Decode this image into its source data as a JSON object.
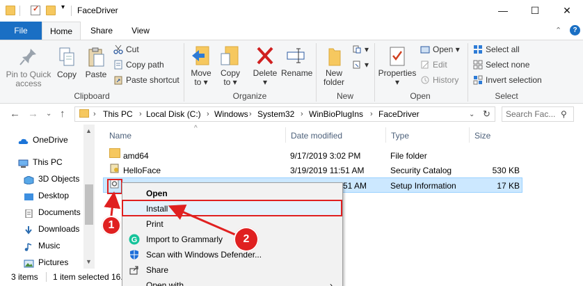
{
  "window": {
    "title": "FaceDriver",
    "minimize": "—",
    "maximize": "☐",
    "close": "✕"
  },
  "tabs": {
    "file": "File",
    "home": "Home",
    "share": "Share",
    "view": "View",
    "help": "?"
  },
  "ribbon": {
    "clipboard": {
      "label": "Clipboard",
      "pin": [
        "Pin to Quick",
        "access"
      ],
      "copy": "Copy",
      "paste": "Paste",
      "cut": "Cut",
      "copy_path": "Copy path",
      "paste_shortcut": "Paste shortcut"
    },
    "organize": {
      "label": "Organize",
      "move_to": [
        "Move",
        "to ▾"
      ],
      "copy_to": [
        "Copy",
        "to ▾"
      ],
      "delete": [
        "Delete",
        "▾"
      ],
      "rename": "Rename"
    },
    "new": {
      "label": "New",
      "new_folder": [
        "New",
        "folder"
      ]
    },
    "open": {
      "label": "Open",
      "properties": [
        "Properties",
        "▾"
      ],
      "open": "Open ▾",
      "edit": "Edit",
      "history": "History"
    },
    "select": {
      "label": "Select",
      "select_all": "Select all",
      "select_none": "Select none",
      "invert": "Invert selection"
    }
  },
  "address": {
    "crumbs": [
      "This PC",
      "Local Disk (C:)",
      "Windows",
      "System32",
      "WinBioPlugIns",
      "FaceDriver"
    ],
    "search_placeholder": "Search Fac..."
  },
  "nav": {
    "items": [
      {
        "label": "OneDrive",
        "icon": "cloud-icon"
      },
      {
        "label": "This PC",
        "icon": "computer-icon"
      },
      {
        "label": "3D Objects",
        "icon": "cube-icon"
      },
      {
        "label": "Desktop",
        "icon": "desktop-icon"
      },
      {
        "label": "Documents",
        "icon": "document-icon"
      },
      {
        "label": "Downloads",
        "icon": "download-icon"
      },
      {
        "label": "Music",
        "icon": "music-icon"
      },
      {
        "label": "Pictures",
        "icon": "pictures-icon"
      }
    ]
  },
  "columns": {
    "name": "Name",
    "date": "Date modified",
    "type": "Type",
    "size": "Size"
  },
  "files": [
    {
      "name": "amd64",
      "date": "9/17/2019 3:02 PM",
      "type": "File folder",
      "size": ""
    },
    {
      "name": "HelloFace",
      "date": "3/19/2019 11:51 AM",
      "type": "Security Catalog",
      "size": "530 KB"
    },
    {
      "name": "",
      "date": "51 AM",
      "type": "Setup Information",
      "size": "17 KB"
    }
  ],
  "context_menu": {
    "items": [
      "Open",
      "Install",
      "Print",
      "Import to Grammarly",
      "Scan with Windows Defender...",
      "Share",
      "Open with"
    ]
  },
  "annotations": {
    "badge1": "1",
    "badge2": "2"
  },
  "status": {
    "count": "3 items",
    "selected": "1 item selected",
    "size_partial": "16."
  },
  "colors": {
    "accent": "#1a6fc4",
    "selection": "#cce8ff",
    "annotation": "#e02020"
  }
}
